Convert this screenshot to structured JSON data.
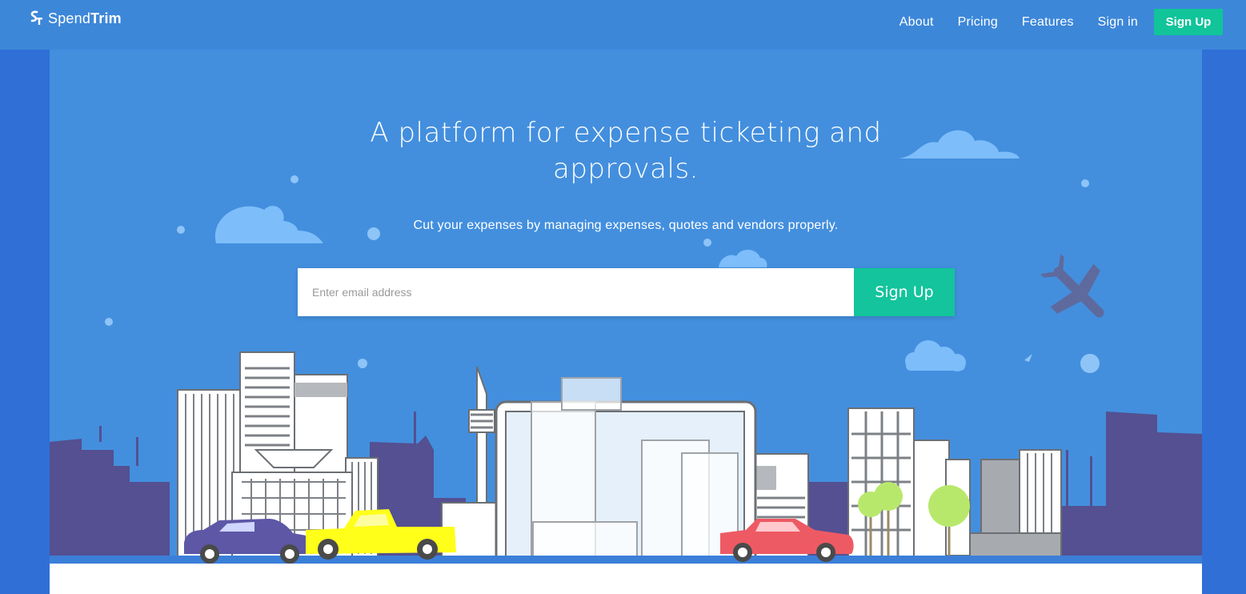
{
  "brand": {
    "name_light": "Spend",
    "name_bold": "Trim"
  },
  "nav": {
    "links": [
      "About",
      "Pricing",
      "Features",
      "Sign in"
    ],
    "signup_label": "Sign Up"
  },
  "hero": {
    "title_line1": "A platform for expense ticketing and",
    "title_line2": "approvals.",
    "subtitle": "Cut your expenses by managing expenses, quotes and vendors properly.",
    "email_placeholder": "Enter email address",
    "signup_button": "Sign Up"
  },
  "colors": {
    "nav_bg": "#3d87d9",
    "hero_bg": "#438fde",
    "page_bg": "#2f6fd6",
    "accent_green": "#13c49c",
    "skyline_purple": "#545091"
  },
  "icons": [
    "logo-mark-icon",
    "cloud-icon",
    "airplane-icon",
    "laptop-icon",
    "car-icon",
    "truck-icon",
    "tree-icon"
  ]
}
